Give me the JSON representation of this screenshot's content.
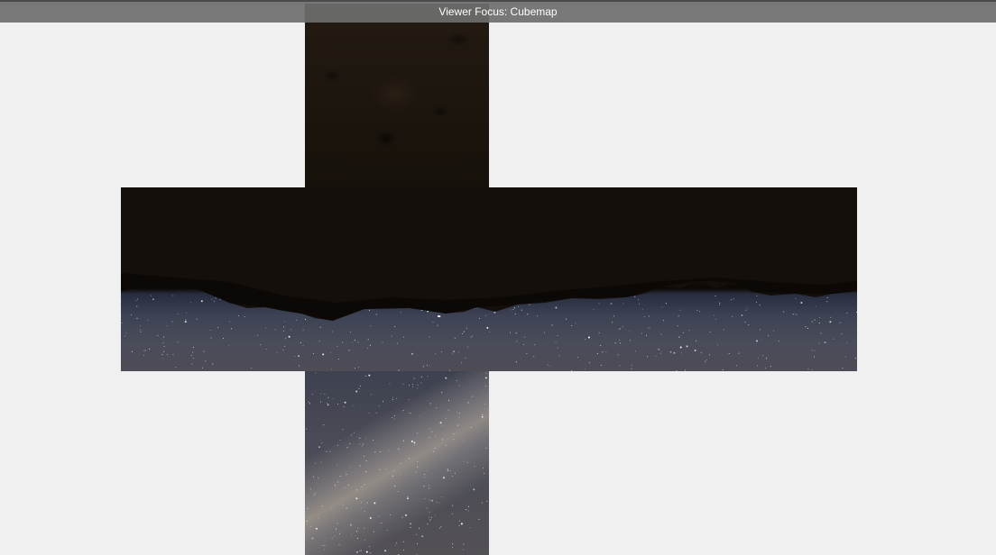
{
  "viewer": {
    "title": "Viewer Focus: Cubemap",
    "faces": [
      {
        "id": "top",
        "content": "ground"
      },
      {
        "id": "left",
        "content": "horizon"
      },
      {
        "id": "front",
        "content": "horizon"
      },
      {
        "id": "right",
        "content": "horizon"
      },
      {
        "id": "back",
        "content": "horizon"
      },
      {
        "id": "bottom",
        "content": "sky"
      }
    ]
  },
  "colors": {
    "background": "#f0f0f0",
    "titlebar": "#6e6e6e",
    "title_text": "#ffffff"
  }
}
